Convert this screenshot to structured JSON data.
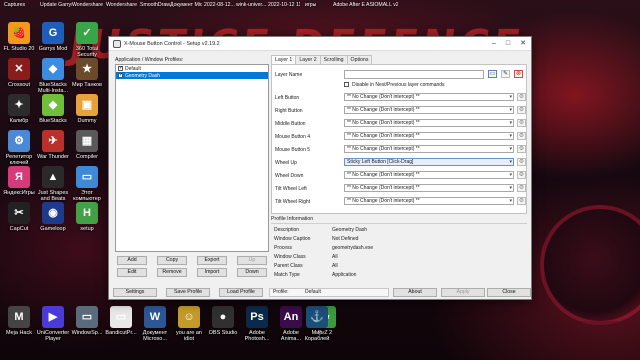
{
  "background": {
    "title_text": "JUSTICE DEFENCE",
    "right_text": "ANCE"
  },
  "top_row_labels": [
    "Captures",
    "Update Garrys Mod",
    "Wondershare UniConvert...",
    "Wondershare Filmora 11",
    "SmoothDraw 4",
    "Документ Microso...",
    "2022-08-12...",
    "wink-univer...",
    "2022-10-12 11-16-23",
    "игры",
    "Adobe After Effects 2020",
    "ASIOMALL v2 Instruction..."
  ],
  "desktop_icons": [
    {
      "label": "FL Studio 20",
      "glyph": "🍓",
      "color": "#f29a1c"
    },
    {
      "label": "Garrys Mod",
      "glyph": "G",
      "color": "#1e5db8"
    },
    {
      "label": "360 Total Security",
      "glyph": "✓",
      "color": "#3aa44a"
    },
    {
      "label": "Crossout",
      "glyph": "✕",
      "color": "#8a1c1c"
    },
    {
      "label": "BlueStacks Multi-Insta...",
      "glyph": "◆",
      "color": "#3c8de0"
    },
    {
      "label": "Мир Танков",
      "glyph": "★",
      "color": "#6b4b2a"
    },
    {
      "label": "Калибр",
      "glyph": "✦",
      "color": "#2c2c2c"
    },
    {
      "label": "BlueStacks",
      "glyph": "◆",
      "color": "#6fbf3a"
    },
    {
      "label": "Dummy",
      "glyph": "▣",
      "color": "#e7a33a"
    },
    {
      "label": "Репетитор ключей",
      "glyph": "⚙",
      "color": "#4b88d6"
    },
    {
      "label": "War Thunder",
      "glyph": "✈",
      "color": "#b8322b"
    },
    {
      "label": "Compiler",
      "glyph": "▦",
      "color": "#5a5a5a"
    },
    {
      "label": "ЯндексИгры",
      "glyph": "Я",
      "color": "#d63a7a"
    },
    {
      "label": "Just Shapes and Beats",
      "glyph": "▲",
      "color": "#2a2a2a"
    },
    {
      "label": "Этот компьютер",
      "glyph": "▭",
      "color": "#3f8ad6"
    },
    {
      "label": "CapCut",
      "glyph": "✂",
      "color": "#222222"
    },
    {
      "label": "Gameloop",
      "glyph": "◉",
      "color": "#1d3b8a"
    },
    {
      "label": "setup",
      "glyph": "H",
      "color": "#43a047"
    },
    {
      "label": "Meja Hack",
      "glyph": "M",
      "color": "#444444"
    },
    {
      "label": "UniConverter Player",
      "glyph": "▶",
      "color": "#4a3ad6"
    },
    {
      "label": "WindowSp...",
      "glyph": "▭",
      "color": "#5a6b7c"
    },
    {
      "label": "BandicutPr...",
      "glyph": "▭",
      "color": "#e8e8e8"
    },
    {
      "label": "Документ Microso...",
      "glyph": "W",
      "color": "#2b5797"
    },
    {
      "label": "you are an idiot",
      "glyph": "☺",
      "color": "#c49a2a"
    },
    {
      "label": "OBS Studio",
      "glyph": "●",
      "color": "#303030"
    },
    {
      "label": "Adobe Photosh...",
      "glyph": "Ps",
      "color": "#0b2a4a"
    },
    {
      "label": "Adobe Anima...",
      "glyph": "An",
      "color": "#3a0c4a"
    },
    {
      "label": "PvZ 2",
      "glyph": "☘",
      "color": "#3b9b3b"
    },
    {
      "label": "Мир Кораблей",
      "glyph": "⚓",
      "color": "#1c4e7a"
    }
  ],
  "dialog": {
    "title": "X-Mouse Button Control - Setup v2.19.2",
    "profiles_header": "Application / Window Profiles:",
    "profiles": [
      {
        "label": "Default",
        "checked": true,
        "selected": false
      },
      {
        "label": "Geometry Dash",
        "checked": true,
        "selected": true
      }
    ],
    "buttons_row1": [
      "Add",
      "Copy",
      "Export",
      "Up"
    ],
    "buttons_row2": [
      "Edit",
      "Remove",
      "Import",
      "Down"
    ],
    "tabs": [
      "Layer 1",
      "Layer 2",
      "Scrolling",
      "Options"
    ],
    "layer_name_label": "Layer Name",
    "next_prev_label": "Disable in Next/Previous layer commands",
    "mappings": [
      {
        "label": "Left Button",
        "value": "** No Change (Don't intercept) **"
      },
      {
        "label": "Right Button",
        "value": "** No Change (Don't intercept) **"
      },
      {
        "label": "Middle Button",
        "value": "** No Change (Don't intercept) **"
      },
      {
        "label": "Mouse Button 4",
        "value": "** No Change (Don't intercept) **"
      },
      {
        "label": "Mouse Button 5",
        "value": "** No Change (Don't intercept) **"
      },
      {
        "label": "Wheel Up",
        "value": "Sticky Left Button [Click-Drag]"
      },
      {
        "label": "Wheel Down",
        "value": "** No Change (Don't intercept) **"
      },
      {
        "label": "Tilt Wheel Left",
        "value": "** No Change (Don't intercept) **"
      },
      {
        "label": "Tilt Wheel Right",
        "value": "** No Change (Don't intercept) **"
      }
    ],
    "info_header": "Profile Information",
    "info": [
      {
        "k": "Description",
        "v": "Geometry Dash"
      },
      {
        "k": "Window Caption",
        "v": "Not Defined"
      },
      {
        "k": "Process",
        "v": "geometrydash.exe"
      },
      {
        "k": "Window Class",
        "v": "All"
      },
      {
        "k": "Parent Class",
        "v": "All"
      },
      {
        "k": "Match Type",
        "v": "Application"
      }
    ],
    "footer": {
      "settings": "Settings",
      "save_profile": "Save Profile",
      "load_profile": "Load Profile",
      "profile_label": "Profile:",
      "profile_value": "Default",
      "about": "About",
      "apply": "Apply",
      "close": "Close"
    }
  }
}
